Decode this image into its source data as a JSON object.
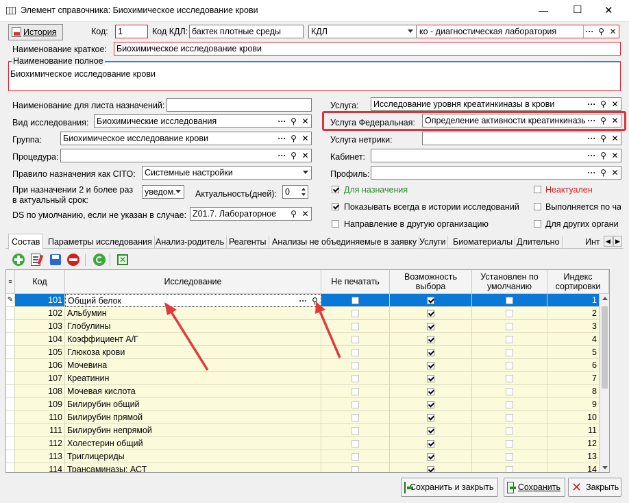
{
  "window": {
    "title": "Элемент справочника: Биохимическое исследование крови",
    "min": "—",
    "max": "☐",
    "close": "✕"
  },
  "header": {
    "history_label": "История",
    "code_label": "Код:",
    "code_value": "1",
    "kdl_label": "Код КДЛ:",
    "kdl_value": "бактек плотные среды",
    "kdl_type": "КДЛ",
    "lab_value": "ко - диагностическая лаборатория",
    "short_name_label": "Наименование краткое:",
    "short_name_value": "Биохимическое исследование крови",
    "full_name_label": "Наименование полное",
    "full_name_value": "Биохимическое исследование крови"
  },
  "form": {
    "sheet_label": "Наименование для листа назначений:",
    "sheet_value": "",
    "type_label": "Вид исследования:",
    "type_value": "Биохимические исследования",
    "group_label": "Группа:",
    "group_value": "Биохимическое исследование крови",
    "procedure_label": "Процедура:",
    "procedure_value": "",
    "cito_label": "Правило назначения как CITO:",
    "cito_value": "Системные настройки",
    "repeat_label": "При назначении 2 и более раз\nв актуальный срок:",
    "repeat_label1": "При назначении 2 и более раз",
    "repeat_label2": "в актуальный срок:",
    "repeat_value": "уведом.",
    "actual_label": "Актуальность(дней):",
    "actual_value": "0",
    "ds_label": "DS по умолчанию, если не указан в случае:",
    "ds_value": "Z01.7. Лабораторное",
    "service_label": "Услуга:",
    "service_value": "Исследование уровня креатинкиназы в крови",
    "fed_label": "Услуга Федеральная:",
    "fed_value": "Определение активности креатинкиназы",
    "nonstd_label": "Услуга нетрики:",
    "nonstd_value": "",
    "cabinet_label": "Кабинет:",
    "cabinet_value": "",
    "profile_label": "Профиль:",
    "profile_value": ""
  },
  "checks": {
    "for_order": "Для назначения",
    "for_order_checked": true,
    "irrelevant": "Неактуален",
    "irrelevant_checked": false,
    "show_always": "Показывать всегда в истории исследований",
    "show_always_checked": true,
    "performed": "Выполняется по ча",
    "performed_checked": false,
    "direction": "Направление в другую организацию",
    "direction_checked": false,
    "other_org": "Для других органи",
    "other_org_checked": false
  },
  "tabs": [
    "Состав",
    "Параметры исследования",
    "Анализ-родитель",
    "Реагенты",
    "Анализы не объединяемые в заявку",
    "Услуги",
    "Биоматериалы",
    "Длительно",
    "Инт"
  ],
  "table": {
    "headers": {
      "code": "Код",
      "study": "Исследование",
      "no_print": "Не печатать",
      "choice": "Возможность выбора",
      "default": "Установлен по умолчанию",
      "sort": "Индекс сортировки"
    },
    "rows": [
      {
        "code": "101",
        "name": "Общий белок",
        "no_print": false,
        "choice": true,
        "default": false,
        "sort": "1"
      },
      {
        "code": "102",
        "name": "Альбумин",
        "no_print": false,
        "choice": true,
        "default": false,
        "sort": "2"
      },
      {
        "code": "103",
        "name": "Глобулины",
        "no_print": false,
        "choice": true,
        "default": false,
        "sort": "3"
      },
      {
        "code": "104",
        "name": "Коэффициент А/Г",
        "no_print": false,
        "choice": true,
        "default": false,
        "sort": "4"
      },
      {
        "code": "105",
        "name": "Глюкоза крови",
        "no_print": false,
        "choice": true,
        "default": false,
        "sort": "5"
      },
      {
        "code": "106",
        "name": "Мочевина",
        "no_print": false,
        "choice": true,
        "default": false,
        "sort": "6"
      },
      {
        "code": "107",
        "name": "Креатинин",
        "no_print": false,
        "choice": true,
        "default": false,
        "sort": "7"
      },
      {
        "code": "108",
        "name": "Мочевая кислота",
        "no_print": false,
        "choice": true,
        "default": false,
        "sort": "8"
      },
      {
        "code": "109",
        "name": "Билирубин общий",
        "no_print": false,
        "choice": true,
        "default": false,
        "sort": "9"
      },
      {
        "code": "110",
        "name": "Билирубин прямой",
        "no_print": false,
        "choice": true,
        "default": false,
        "sort": "10"
      },
      {
        "code": "111",
        "name": "Билирубин непрямой",
        "no_print": false,
        "choice": true,
        "default": false,
        "sort": "11"
      },
      {
        "code": "112",
        "name": "Холестерин общий",
        "no_print": false,
        "choice": true,
        "default": false,
        "sort": "12"
      },
      {
        "code": "113",
        "name": "Триглицериды",
        "no_print": false,
        "choice": true,
        "default": false,
        "sort": "13"
      },
      {
        "code": "114",
        "name": "Трансаминазы: АСТ",
        "no_print": false,
        "choice": true,
        "default": false,
        "sort": "14"
      }
    ]
  },
  "footer": {
    "save_close": "Сохранить и закрыть",
    "save": "Сохранить",
    "close": "Закрыть"
  },
  "colors": {
    "accent_red": "#e0202a",
    "selection": "#0a78d7",
    "row_bg": "#fbfbdc",
    "green_text": "#2a8a2a",
    "red_text": "#d02020"
  }
}
